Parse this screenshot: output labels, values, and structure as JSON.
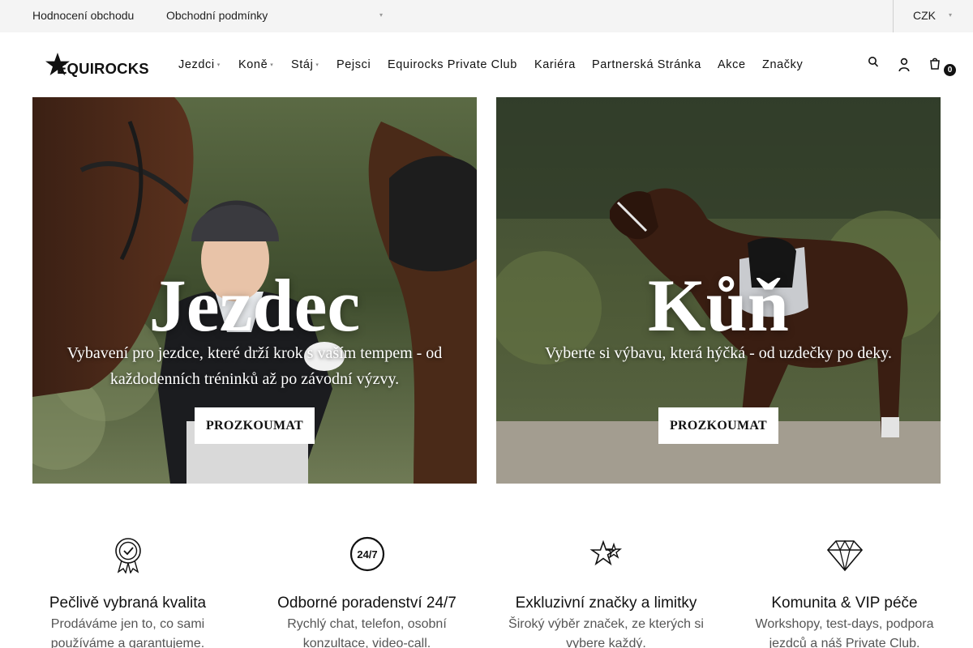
{
  "topbar": {
    "links": [
      "Hodnocení obchodu",
      "Obchodní podmínky"
    ],
    "currency": "CZK"
  },
  "header": {
    "logo_text": "EQUIROCKS",
    "nav": [
      {
        "label": "Jezdci",
        "has_dropdown": true
      },
      {
        "label": "Koně",
        "has_dropdown": true
      },
      {
        "label": "Stáj",
        "has_dropdown": true
      },
      {
        "label": "Pejsci",
        "has_dropdown": false
      },
      {
        "label": "Equirocks Private Club",
        "has_dropdown": false
      },
      {
        "label": "Kariéra",
        "has_dropdown": false
      },
      {
        "label": "Partnerská Stránka",
        "has_dropdown": false
      },
      {
        "label": "Akce",
        "has_dropdown": false
      },
      {
        "label": "Značky",
        "has_dropdown": false
      }
    ],
    "icons": [
      "search-icon",
      "user-icon",
      "cart-icon"
    ],
    "cart_count": "0"
  },
  "banners": [
    {
      "title": "Jezdec",
      "subtitle": "Vybavení pro jezdce, které drží krok s vaším tempem - od každodenních tréninků až po závodní výzvy.",
      "button": "PROZKOUMAT"
    },
    {
      "title": "Kůň",
      "subtitle": "Vyberte si výbavu, která hýčká - od uzdečky po deky.",
      "button": "PROZKOUMAT"
    }
  ],
  "features": [
    {
      "icon": "quality-badge-icon",
      "title": "Pečlivě vybraná kvalita",
      "desc": "Prodáváme jen to, co sami používáme a garantujeme."
    },
    {
      "icon": "support-24-7-icon",
      "title": "Odborné poradenství 24/7",
      "desc": "Rychlý chat, telefon, osobní konzultace, video-call."
    },
    {
      "icon": "stars-icon",
      "title": "Exkluzivní značky a limitky",
      "desc": "Široký výběr značek, ze kterých si vybere každý."
    },
    {
      "icon": "diamond-icon",
      "title": "Komunita & VIP péče",
      "desc": "Workshopy, test-days, podpora jezdců a náš Private Club."
    }
  ],
  "colors": {
    "topbar_bg": "#f4f4f4",
    "text": "#111111",
    "muted_text": "#555555",
    "button_bg": "#ffffff"
  }
}
